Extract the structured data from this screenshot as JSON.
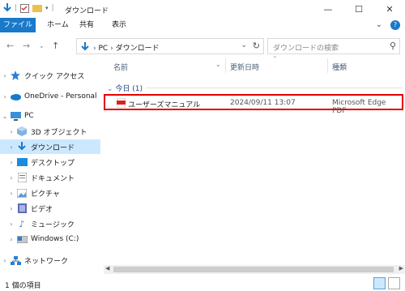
{
  "window": {
    "title": "ダウンロード"
  },
  "ribbon": {
    "tabs": [
      "ファイル",
      "ホーム",
      "共有",
      "表示"
    ]
  },
  "address": {
    "path": [
      "PC",
      "ダウンロード"
    ],
    "search_placeholder": "ダウンロードの検索"
  },
  "sidebar": {
    "items": [
      {
        "label": "クイック アクセス",
        "icon": "star-icon"
      },
      {
        "label": "OneDrive - Personal",
        "icon": "cloud-icon"
      },
      {
        "label": "PC",
        "icon": "pc-icon"
      },
      {
        "label": "3D オブジェクト",
        "icon": "cube-icon"
      },
      {
        "label": "ダウンロード",
        "icon": "download-icon"
      },
      {
        "label": "デスクトップ",
        "icon": "desktop-icon"
      },
      {
        "label": "ドキュメント",
        "icon": "document-icon"
      },
      {
        "label": "ピクチャ",
        "icon": "picture-icon"
      },
      {
        "label": "ビデオ",
        "icon": "video-icon"
      },
      {
        "label": "ミュージック",
        "icon": "music-icon"
      },
      {
        "label": "Windows (C:)",
        "icon": "drive-icon"
      },
      {
        "label": "ネットワーク",
        "icon": "network-icon"
      }
    ]
  },
  "list": {
    "columns": [
      "名前",
      "更新日時",
      "種類"
    ],
    "group": "今日 (1)",
    "files": [
      {
        "name": "ユーザーズマニュアル",
        "modified": "2024/09/11 13:07",
        "type": "Microsoft Edge PDF"
      }
    ]
  },
  "status": {
    "count": "1 個の項目"
  },
  "colors": {
    "accent": "#1979ca",
    "selected": "#cce8ff",
    "highlight": "#e30000"
  }
}
